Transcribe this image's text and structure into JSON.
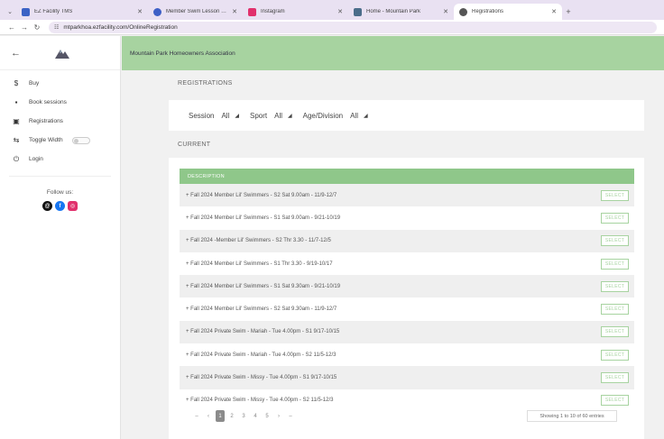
{
  "browser": {
    "tabs": [
      {
        "label": "EZ Facility TMS",
        "color": "#3b62c5",
        "active": false
      },
      {
        "label": "Member Swim Lesson Guide - ",
        "color": "#3d5fc6",
        "active": false
      },
      {
        "label": "Instagram",
        "color": "#e1306c",
        "active": false
      },
      {
        "label": "Home - Mountain Park",
        "color": "#4b6d8a",
        "active": false
      },
      {
        "label": "Registrations",
        "color": "#555555",
        "active": true
      }
    ],
    "url": "mtparkhoa.ezfacility.com/OnlineRegistration"
  },
  "sidebar": {
    "items": [
      {
        "icon": "$",
        "label": "Buy"
      },
      {
        "icon": "▪",
        "label": "Book sessions"
      },
      {
        "icon": "▣",
        "label": "Registrations"
      },
      {
        "icon": "⇆",
        "label": "Toggle Width"
      },
      {
        "icon": "⏻",
        "label": "Login"
      }
    ],
    "follow_label": "Follow us:"
  },
  "header": {
    "org_name": "Mountain Park Homeowners Association"
  },
  "registrations": {
    "title": "REGISTRATIONS",
    "filters": [
      {
        "label": "Session",
        "value": "All"
      },
      {
        "label": "Sport",
        "value": "All"
      },
      {
        "label": "Age/Division",
        "value": "All"
      }
    ]
  },
  "current": {
    "title": "CURRENT",
    "column_header": "DESCRIPTION",
    "select_label": "SELECT",
    "rows": [
      "+ Fall 2024 Member Lil' Swimmers - S2 Sat 9.00am - 11/9-12/7",
      "+ Fall 2024 Member Lil' Swimmers - S1 Sat 9.00am - 9/21-10/19",
      "+ Fall 2024 -Member Lil' Swimmers - S2 Thr 3.30 - 11/7-12/5",
      "+ Fall 2024 Member Lil' Swimmers - S1 Thr 3.30 - 9/19-10/17",
      "+ Fall 2024 Member Lil' Swimmers - S1 Sat 9.30am - 9/21-10/19",
      "+ Fall 2024 Member Lil' Swimmers - S2 Sat 9.30am - 11/9-12/7",
      "+ Fall 2024 Private Swim - Mariah - Tue 4.00pm - S1 9/17-10/15",
      "+ Fall 2024 Private Swim - Mariah - Tue 4.00pm - S2 11/5-12/3",
      "+ Fall 2024 Private Swim - Missy - Tue 4.00pm - S1 9/17-10/15",
      "+ Fall 2024 Private Swim - Missy - Tue 4.00pm - S2 11/5-12/3"
    ],
    "pagination": [
      "–",
      "‹",
      "1",
      "2",
      "3",
      "4",
      "5",
      "›",
      "–"
    ],
    "active_page": "1",
    "showing_text": "Showing 1 to 10 of 60 entries"
  },
  "colors": {
    "accent_green": "#a7d3a0",
    "header_green": "#8fc78a"
  }
}
